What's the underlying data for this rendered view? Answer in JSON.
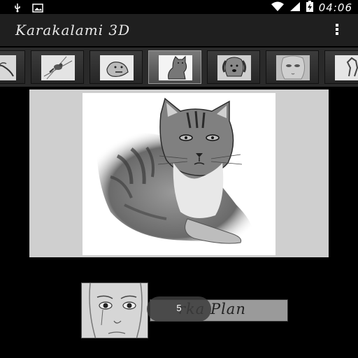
{
  "status_bar": {
    "time": "04:06",
    "icons": [
      "usb-icon",
      "image-notification-icon",
      "wifi-icon",
      "signal-icon",
      "battery-charging-icon"
    ]
  },
  "action_bar": {
    "title": "Karakalami 3D",
    "menu_icon": "overflow-menu-icon"
  },
  "thumbnails": [
    {
      "subject": "hand"
    },
    {
      "subject": "bird"
    },
    {
      "subject": "dog"
    },
    {
      "subject": "cat",
      "selected": true
    },
    {
      "subject": "golden-retriever"
    },
    {
      "subject": "face"
    },
    {
      "subject": "horse"
    }
  ],
  "main_image": {
    "subject": "cat"
  },
  "bottom": {
    "thumb_subject": "face",
    "button_label": "Arka Plan",
    "button_label_visible": "rka Plan",
    "counter": "5"
  },
  "colors": {
    "background": "#000000",
    "action_bar": "#1f1f1f",
    "strip": "#2a2a2a",
    "frame": "#cfcfcf"
  }
}
